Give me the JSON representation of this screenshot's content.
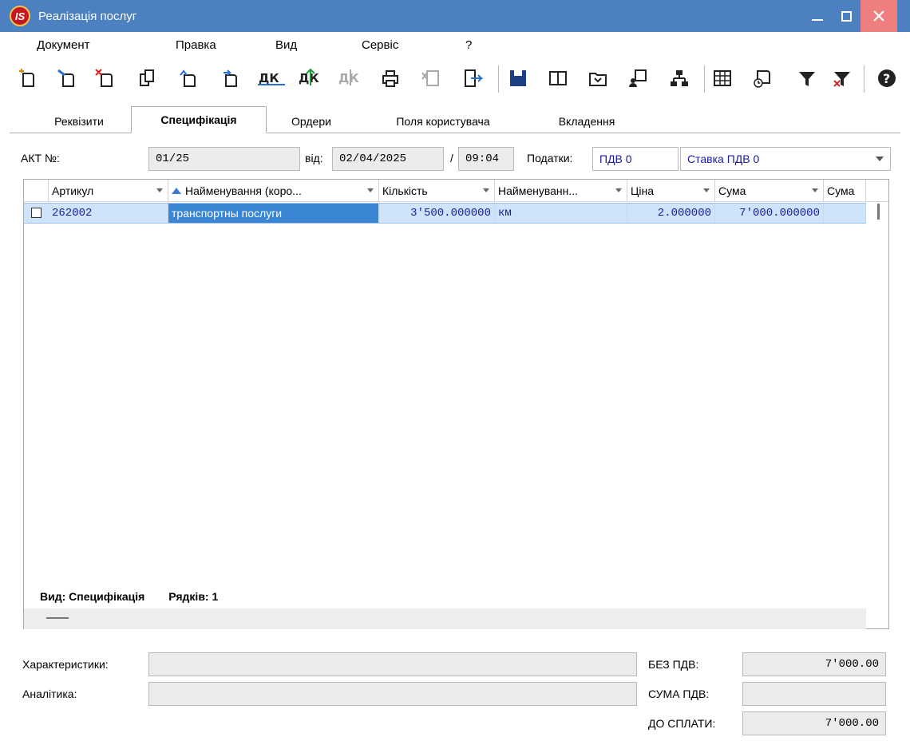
{
  "window": {
    "title": "Реалізація послуг",
    "logo_text": "IS"
  },
  "menu": [
    "Документ",
    "Правка",
    "Вид",
    "Сервіс",
    "?"
  ],
  "toolbar": {
    "icons": [
      "new-doc-icon",
      "edit-doc-icon",
      "delete-doc-icon",
      "copy-doc-icon",
      "return-doc-icon",
      "forward-doc-icon",
      "dk-icon",
      "dk-green-icon",
      "dk-disabled-icon",
      "print-icon",
      "excel-disabled-icon",
      "export-icon",
      "save-icon",
      "book-icon",
      "folder-icon",
      "user-icon",
      "hierarchy-icon",
      "table-icon",
      "history-icon",
      "filter-icon",
      "clear-filter-icon",
      "help-icon"
    ]
  },
  "tabs": [
    "Реквізити",
    "Специфікація",
    "Ордери",
    "Поля користувача",
    "Вкладення"
  ],
  "active_tab": "Специфікація",
  "header": {
    "act_label": "АКТ №:",
    "act_number": "01/25",
    "date_label": "від:",
    "date": "02/04/2025",
    "time_sep": "/",
    "time": "09:04",
    "taxes_label": "Податки:",
    "tax_code": "ПДВ  0",
    "tax_rate": "Ставка ПДВ 0"
  },
  "table": {
    "columns": [
      "Артикул",
      "Найменування (коро...",
      "Кількість",
      "Найменуванн...",
      "Ціна",
      "Сума",
      "Сума"
    ],
    "rows": [
      {
        "article": "262002",
        "name": "транспортны послуги",
        "qty": "3'500.000000",
        "unit": "км",
        "price": "2.000000",
        "sum": "7'000.000000",
        "sum2": ""
      }
    ],
    "footer_view": "Вид: Специфікація",
    "footer_rows": "Рядків: 1"
  },
  "bottom": {
    "characteristics_label": "Характеристики:",
    "characteristics_value": "",
    "analytics_label": "Аналітика:",
    "analytics_value": "",
    "no_vat_label": "БЕЗ ПДВ:",
    "no_vat_value": "7'000.00",
    "vat_sum_label": "СУМА ПДВ:",
    "vat_sum_value": "",
    "to_pay_label": "ДО СПЛАТИ:",
    "to_pay_value": "7'000.00"
  },
  "colors": {
    "titlebar": "#4d80c0",
    "close_button": "#ef7f7f",
    "row_selected": "#cfe3fb",
    "cell_focus": "#3a86d4"
  }
}
